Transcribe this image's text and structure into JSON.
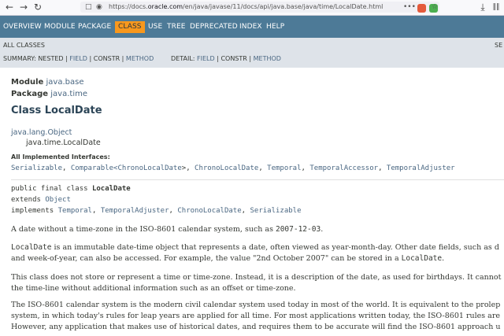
{
  "browser": {
    "back_icon": "←",
    "forward_icon": "→",
    "reload_icon": "↻",
    "url_prefix": "https://docs.",
    "url_domain": "oracle.com",
    "url_path": "/en/java/javase/11/docs/api/java.base/java/time/LocalDate.html",
    "more_icon": "•••",
    "star_icon": "☆",
    "download_icon": "⤓",
    "library_icon": "‖‖",
    "extension_colors": [
      "#e45a3c",
      "#4caf50"
    ]
  },
  "topnav": {
    "items": [
      "OVERVIEW",
      "MODULE",
      "PACKAGE",
      "CLASS",
      "USE",
      "TREE",
      "DEPRECATED",
      "INDEX",
      "HELP"
    ],
    "active": "CLASS",
    "accent": "#f8981d"
  },
  "subnav": {
    "all_classes": "ALL CLASSES",
    "search_stub": "SE",
    "summary_label": "SUMMARY: NESTED | ",
    "summary_field": "FIELD",
    "summary_sep": " | CONSTR | ",
    "summary_method": "METHOD",
    "detail_label": "DETAIL: ",
    "detail_field": "FIELD",
    "detail_sep": " | CONSTR | ",
    "detail_method": "METHOD"
  },
  "header": {
    "module_label": "Module",
    "module_name": "java.base",
    "package_label": "Package",
    "package_name": "java.time",
    "class_title": "Class LocalDate"
  },
  "hierarchy": {
    "parent": "java.lang.Object",
    "child": "java.time.LocalDate"
  },
  "interfaces": {
    "label": "All Implemented Interfaces:",
    "i1": "Serializable",
    "i2_pre": "Comparable<",
    "i2_inner": "ChronoLocalDate",
    "i2_post": ">",
    "i3": "ChronoLocalDate",
    "i4": "Temporal",
    "i5": "TemporalAccessor",
    "i6": "TemporalAdjuster",
    "comma": ", "
  },
  "signature": {
    "line1_pre": "public final class ",
    "line1_name": "LocalDate",
    "line2_pre": "extends ",
    "line2_link": "Object",
    "line3_pre": "implements ",
    "impl1": "Temporal",
    "impl2": "TemporalAdjuster",
    "impl3": "ChronoLocalDate",
    "impl4": "Serializable",
    "comma": ", "
  },
  "description": {
    "p1_pre": "A date without a time-zone in the ISO-8601 calendar system, such as ",
    "p1_code": "2007-12-03",
    "p1_post": ".",
    "p2_code1": "LocalDate",
    "p2_l1": " is an immutable date-time object that represents a date, often viewed as year-month-day. Other date fields, such as d",
    "p2_l2_pre": "and week-of-year, can also be accessed. For example, the value \"2nd October 2007\" can be stored in a ",
    "p2_code2": "LocalDate",
    "p2_l2_post": ".",
    "p3_l1": "This class does not store or represent a time or time-zone. Instead, it is a description of the date, as used for birthdays. It cannot",
    "p3_l2": "the time-line without additional information such as an offset or time-zone.",
    "p4_l1": "The ISO-8601 calendar system is the modern civil calendar system used today in most of the world. It is equivalent to the prolep",
    "p4_l2": "system, in which today's rules for leap years are applied for all time. For most applications written today, the ISO-8601 rules are",
    "p4_l3": "However, any application that makes use of historical dates, and requires them to be accurate will find the ISO-8601 approach u"
  }
}
